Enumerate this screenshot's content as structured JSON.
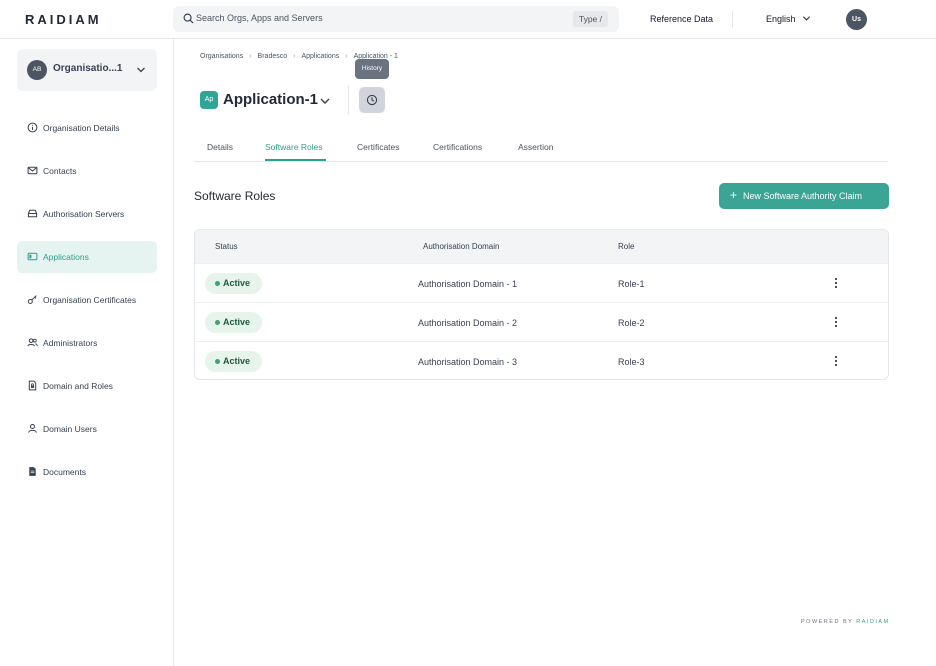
{
  "header": {
    "logo": "RAIDIAM",
    "search_placeholder": "Search Orgs, Apps and Servers",
    "search_shortcut": "Type /",
    "reference_data": "Reference Data",
    "language": "English",
    "user_initials": "Us"
  },
  "sidebar": {
    "org": {
      "initials": "AB",
      "name": "Organisatio...1"
    },
    "items": [
      {
        "label": "Organisation Details",
        "icon": "info-icon",
        "active": false
      },
      {
        "label": "Contacts",
        "icon": "mail-icon",
        "active": false
      },
      {
        "label": "Authorisation Servers",
        "icon": "server-icon",
        "active": false
      },
      {
        "label": "Applications",
        "icon": "app-icon",
        "active": true
      },
      {
        "label": "Organisation Certificates",
        "icon": "key-icon",
        "active": false
      },
      {
        "label": "Administrators",
        "icon": "users-icon",
        "active": false
      },
      {
        "label": "Domain and Roles",
        "icon": "document-lock-icon",
        "active": false
      },
      {
        "label": "Domain Users",
        "icon": "user-icon",
        "active": false
      },
      {
        "label": "Documents",
        "icon": "document-icon",
        "active": false
      }
    ]
  },
  "breadcrumb": [
    "Organisations",
    "Bradesco",
    "Applications",
    "Application - 1"
  ],
  "app": {
    "badge": "Ap",
    "title": "Application-1",
    "history_tooltip": "History"
  },
  "tabs": [
    {
      "label": "Details",
      "active": false
    },
    {
      "label": "Software Roles",
      "active": true
    },
    {
      "label": "Certificates",
      "active": false
    },
    {
      "label": "Certifications",
      "active": false
    },
    {
      "label": "Assertion",
      "active": false
    }
  ],
  "section": {
    "title": "Software Roles",
    "new_button": "New Software Authority Claim"
  },
  "table": {
    "columns": [
      "Status",
      "Authorisation Domain",
      "Role"
    ],
    "rows": [
      {
        "status": "Active",
        "domain": "Authorisation Domain - 1",
        "role": "Role-1"
      },
      {
        "status": "Active",
        "domain": "Authorisation Domain - 2",
        "role": "Role-2"
      },
      {
        "status": "Active",
        "domain": "Authorisation Domain - 3",
        "role": "Role-3"
      }
    ]
  },
  "footer": {
    "powered_by": "POWERED BY",
    "brand": "RAIDIAM"
  },
  "colors": {
    "accent": "#2e9e8e",
    "button": "#3aa595",
    "active_bg": "#e6f4f1",
    "status_bg": "#e6f4ec",
    "status_dot": "#3aa66a"
  }
}
